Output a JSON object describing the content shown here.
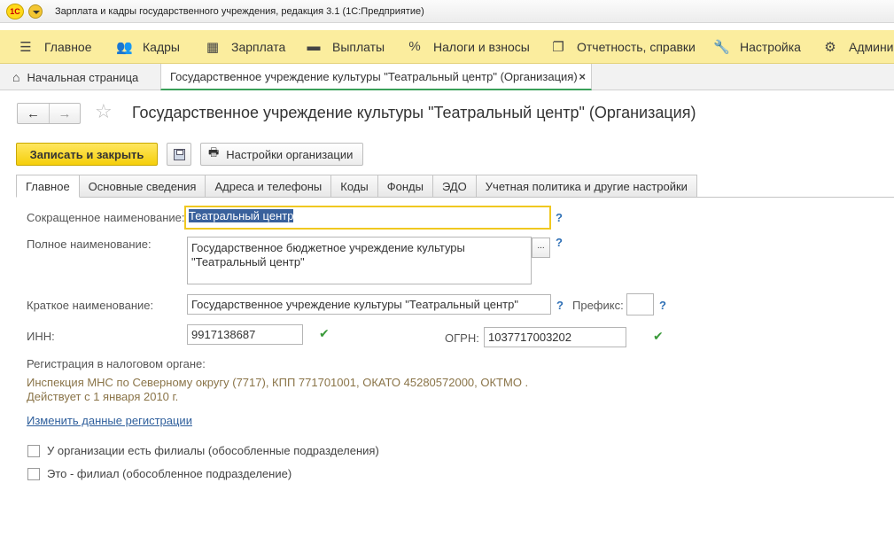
{
  "window": {
    "title": "Зарплата и кадры государственного учреждения, редакция 3.1  (1С:Предприятие)",
    "logo": "1С"
  },
  "sections": [
    {
      "label": "Главное",
      "icon": "menu-icon"
    },
    {
      "label": "Кадры",
      "icon": "people-icon"
    },
    {
      "label": "Зарплата",
      "icon": "calculator-icon"
    },
    {
      "label": "Выплаты",
      "icon": "wallet-icon"
    },
    {
      "label": "Налоги и взносы",
      "icon": "percent-icon"
    },
    {
      "label": "Отчетность, справки",
      "icon": "reports-icon"
    },
    {
      "label": "Настройка",
      "icon": "wrench-icon"
    },
    {
      "label": "Админис",
      "icon": "gear-icon"
    }
  ],
  "window_tabs": {
    "home": "Начальная страница",
    "active": "Государственное учреждение культуры \"Театральный центр\" (Организация)",
    "close": "×"
  },
  "form": {
    "title": "Государственное учреждение культуры \"Театральный центр\" (Организация)",
    "nav_back": "←",
    "nav_forward": "→",
    "favorite": "☆"
  },
  "commands": {
    "save_close": "Записать и закрыть",
    "org_settings": "Настройки организации"
  },
  "tabs": [
    "Главное",
    "Основные сведения",
    "Адреса и телефоны",
    "Коды",
    "Фонды",
    "ЭДО",
    "Учетная политика и другие настройки"
  ],
  "fields": {
    "short_name_label": "Сокращенное наименование:",
    "short_name_value": "Театральный центр",
    "full_name_label": "Полное наименование:",
    "full_name_line1": "Государственное бюджетное учреждение культуры",
    "full_name_line2": "\"Театральный центр\"",
    "brief_name_label": "Краткое наименование:",
    "brief_name_value": "Государственное учреждение культуры \"Театральный центр\"",
    "prefix_label": "Префикс:",
    "prefix_value": "",
    "inn_label": "ИНН:",
    "inn_value": "9917138687",
    "ogrn_label": "ОГРН:",
    "ogrn_value": "1037717003202",
    "help": "?",
    "ok_mark": "✔",
    "dots": "..."
  },
  "registration": {
    "title": "Регистрация в налоговом органе:",
    "line1": "Инспекция МНС по Северному округу (7717), КПП 771701001, ОКАТО 45280572000, ОКТМО .",
    "line2": "Действует с 1 января 2010 г.",
    "change_link": "Изменить данные регистрации"
  },
  "checkboxes": {
    "branches": "У организации есть филиалы (обособленные подразделения)",
    "is_branch": "Это - филиал (обособленное подразделение)"
  }
}
